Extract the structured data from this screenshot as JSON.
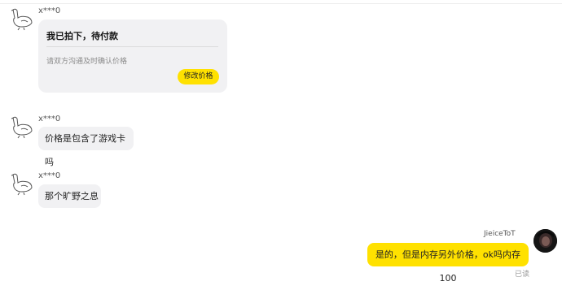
{
  "messages": [
    {
      "sender": "x***0",
      "title": "我已拍下，待付款",
      "hint": "请双方沟通及时确认价格",
      "button": "修改价格"
    },
    {
      "sender": "x***0",
      "text": "价格是包含了游戏卡吗"
    },
    {
      "sender": "x***0",
      "text": "那个旷野之息"
    }
  ],
  "me": {
    "name": "JieiceToT",
    "text": "是的，但是内存另外价格，ok吗内存100",
    "status": "已读"
  },
  "colors": {
    "accent": "#ffe100",
    "bubble": "#f1f1f3"
  },
  "icons": {
    "other_avatar": "goose-sketch-icon",
    "my_avatar": "dark-photo-avatar"
  }
}
